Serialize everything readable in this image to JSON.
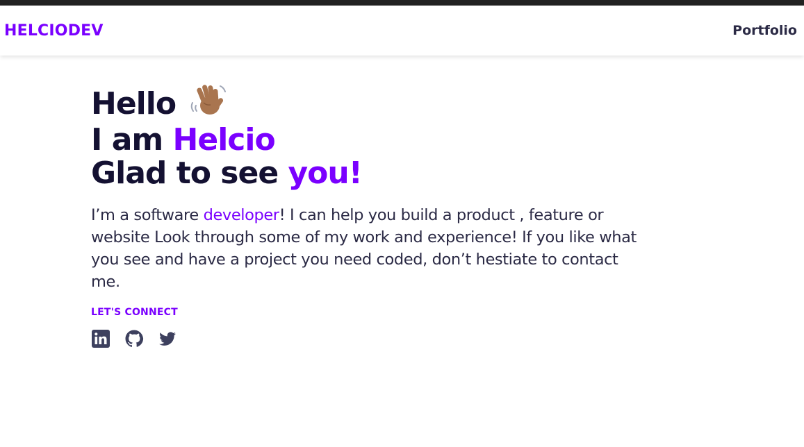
{
  "navbar": {
    "brand": "HELCIODEV",
    "link_portfolio": "Portfolio"
  },
  "hero": {
    "line1": "Hello",
    "line2_prefix": "I am ",
    "line2_name": "Helcio",
    "line3_prefix": "Glad to see ",
    "line3_accent": "you!",
    "wave_icon": "waving-hand-icon",
    "bio_prefix": "I’m a software ",
    "bio_accent": "developer",
    "bio_rest": "! I can help you build a product , feature or website Look through some of my work and experience! If you like what you see and have a project you need coded, don’t hestiate to contact me.",
    "connect_label": "LET'S CONNECT"
  },
  "socials": [
    {
      "icon": "linkedin-icon"
    },
    {
      "icon": "github-icon"
    },
    {
      "icon": "twitter-icon"
    }
  ],
  "colors": {
    "accent": "#7a00ff",
    "heading": "#141132",
    "text": "#2b2a45",
    "icon": "#3d405e"
  }
}
